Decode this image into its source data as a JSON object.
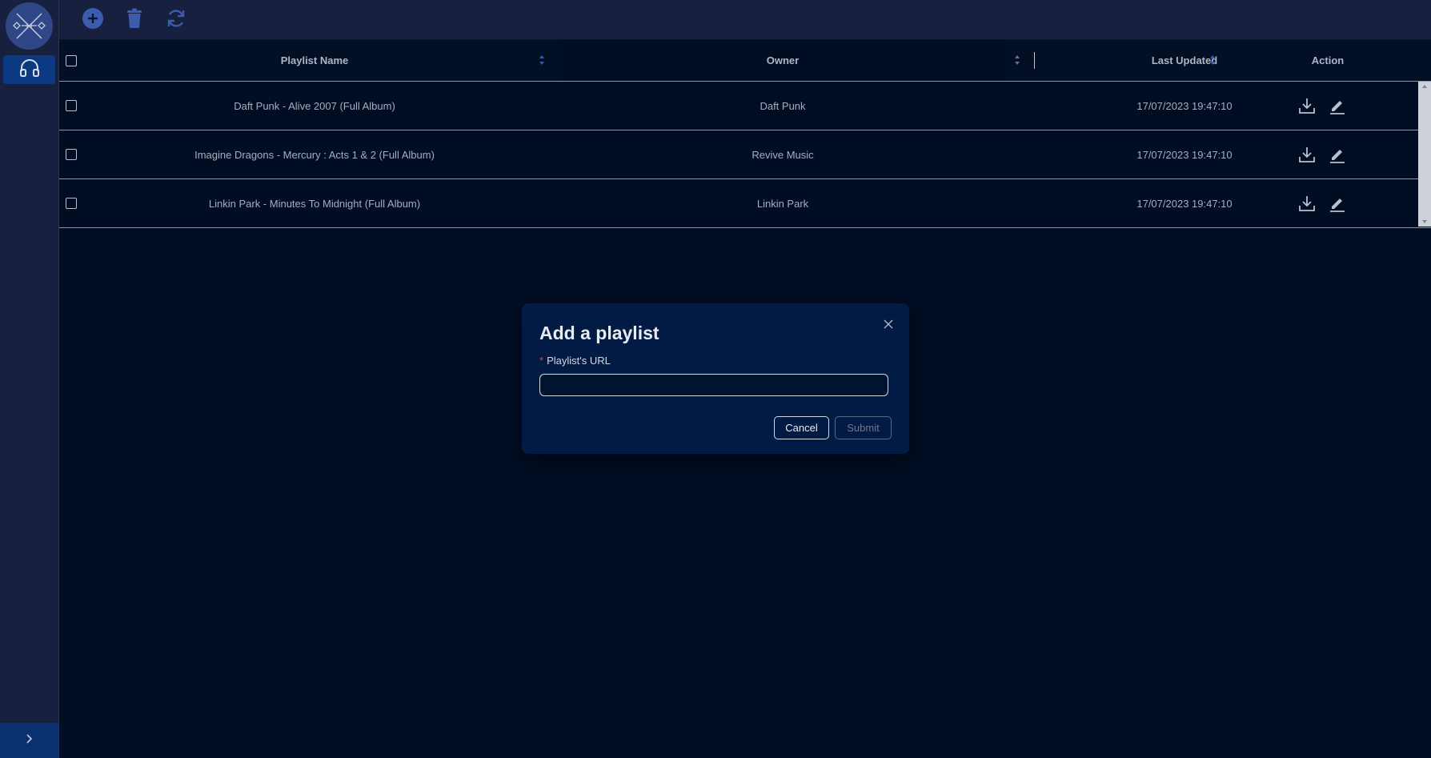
{
  "sidebar": {
    "logo_icon": "app-logo-icon",
    "nav_icon": "headphones-icon",
    "collapse_icon": "chevron-right-icon"
  },
  "toolbar": {
    "add_icon": "plus-circle-icon",
    "delete_icon": "trash-icon",
    "refresh_icon": "refresh-icon"
  },
  "table": {
    "headers": {
      "name": "Playlist Name",
      "owner": "Owner",
      "updated": "Last Updated",
      "action": "Action"
    },
    "rows": [
      {
        "name": "Daft Punk - Alive 2007 (Full Album)",
        "owner": "Daft Punk",
        "updated": "17/07/2023 19:47:10"
      },
      {
        "name": "Imagine Dragons - Mercury : Acts 1 & 2 (Full Album)",
        "owner": "Revive Music",
        "updated": "17/07/2023 19:47:10"
      },
      {
        "name": "Linkin Park - Minutes To Midnight (Full Album)",
        "owner": "Linkin Park",
        "updated": "17/07/2023 19:47:10"
      }
    ]
  },
  "modal": {
    "title": "Add a playlist",
    "required_mark": "*",
    "field_label": "Playlist's URL",
    "field_value": "",
    "field_placeholder": "",
    "cancel_label": "Cancel",
    "submit_label": "Submit"
  },
  "colors": {
    "background": "#000d22",
    "sidebar": "#17203f",
    "accent": "#0c3a82",
    "modal": "#021b44",
    "required": "#e0424b"
  }
}
